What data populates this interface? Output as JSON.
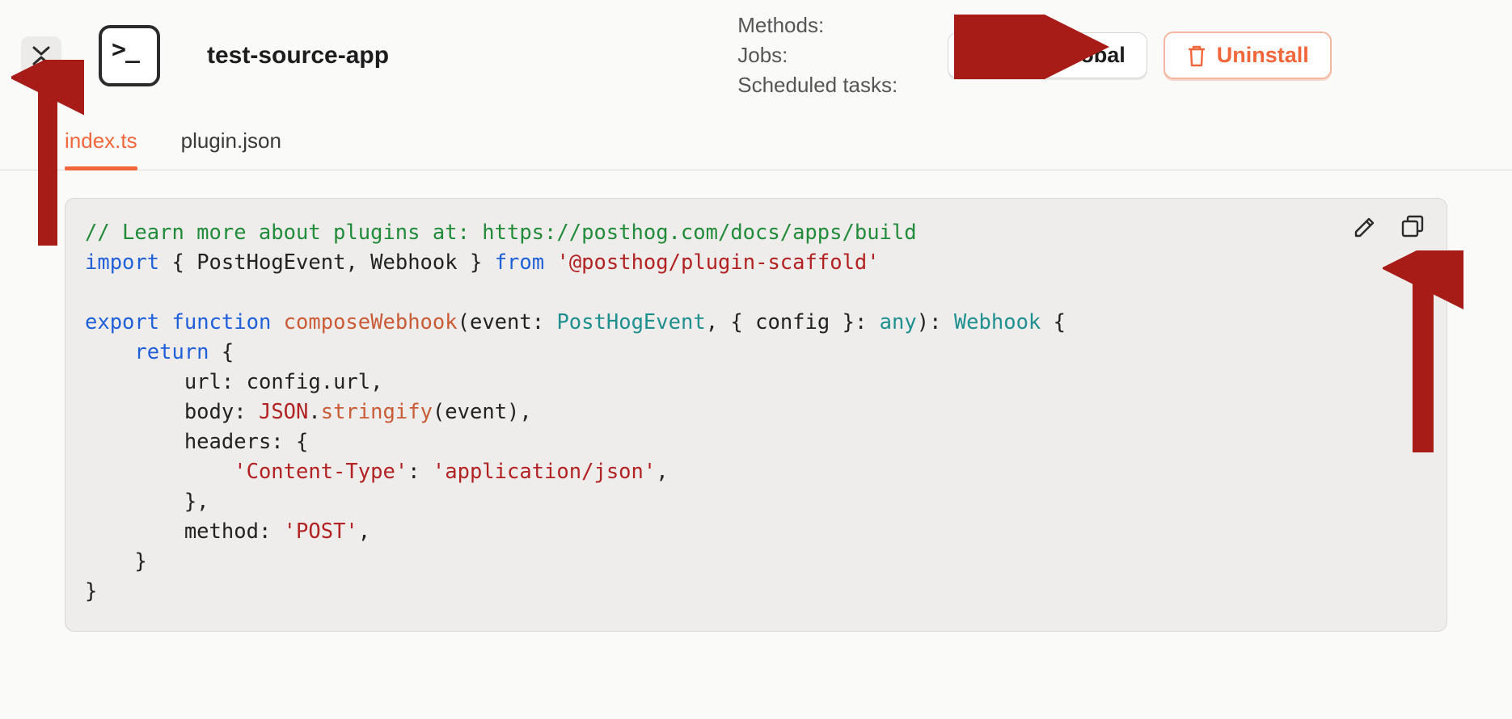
{
  "header": {
    "app_title": "test-source-app",
    "meta": {
      "methods_label": "Methods:",
      "jobs_label": "Jobs:",
      "scheduled_label": "Scheduled tasks:"
    },
    "buttons": {
      "make_global": "Make global",
      "uninstall": "Uninstall"
    }
  },
  "tabs": [
    {
      "label": "index.ts",
      "active": true
    },
    {
      "label": "plugin.json",
      "active": false
    }
  ],
  "code": {
    "comment": "// Learn more about plugins at: https://posthog.com/docs/apps/build",
    "import_kw": "import",
    "import_names": "PostHogEvent, Webhook",
    "from_kw": "from",
    "import_module": "'@posthog/plugin-scaffold'",
    "export_kw": "export",
    "function_kw": "function",
    "fn_name": "composeWebhook",
    "param_event": "event",
    "type_event": "PostHogEvent",
    "param_config": "config",
    "type_any": "any",
    "type_return": "Webhook",
    "return_kw": "return",
    "prop_url": "url",
    "val_url": "config.url",
    "prop_body": "body",
    "val_body_obj": "JSON",
    "val_body_fn": "stringify",
    "val_body_arg": "event",
    "prop_headers": "headers",
    "hdr_key": "'Content-Type'",
    "hdr_val": "'application/json'",
    "prop_method": "method",
    "val_method": "'POST'"
  }
}
